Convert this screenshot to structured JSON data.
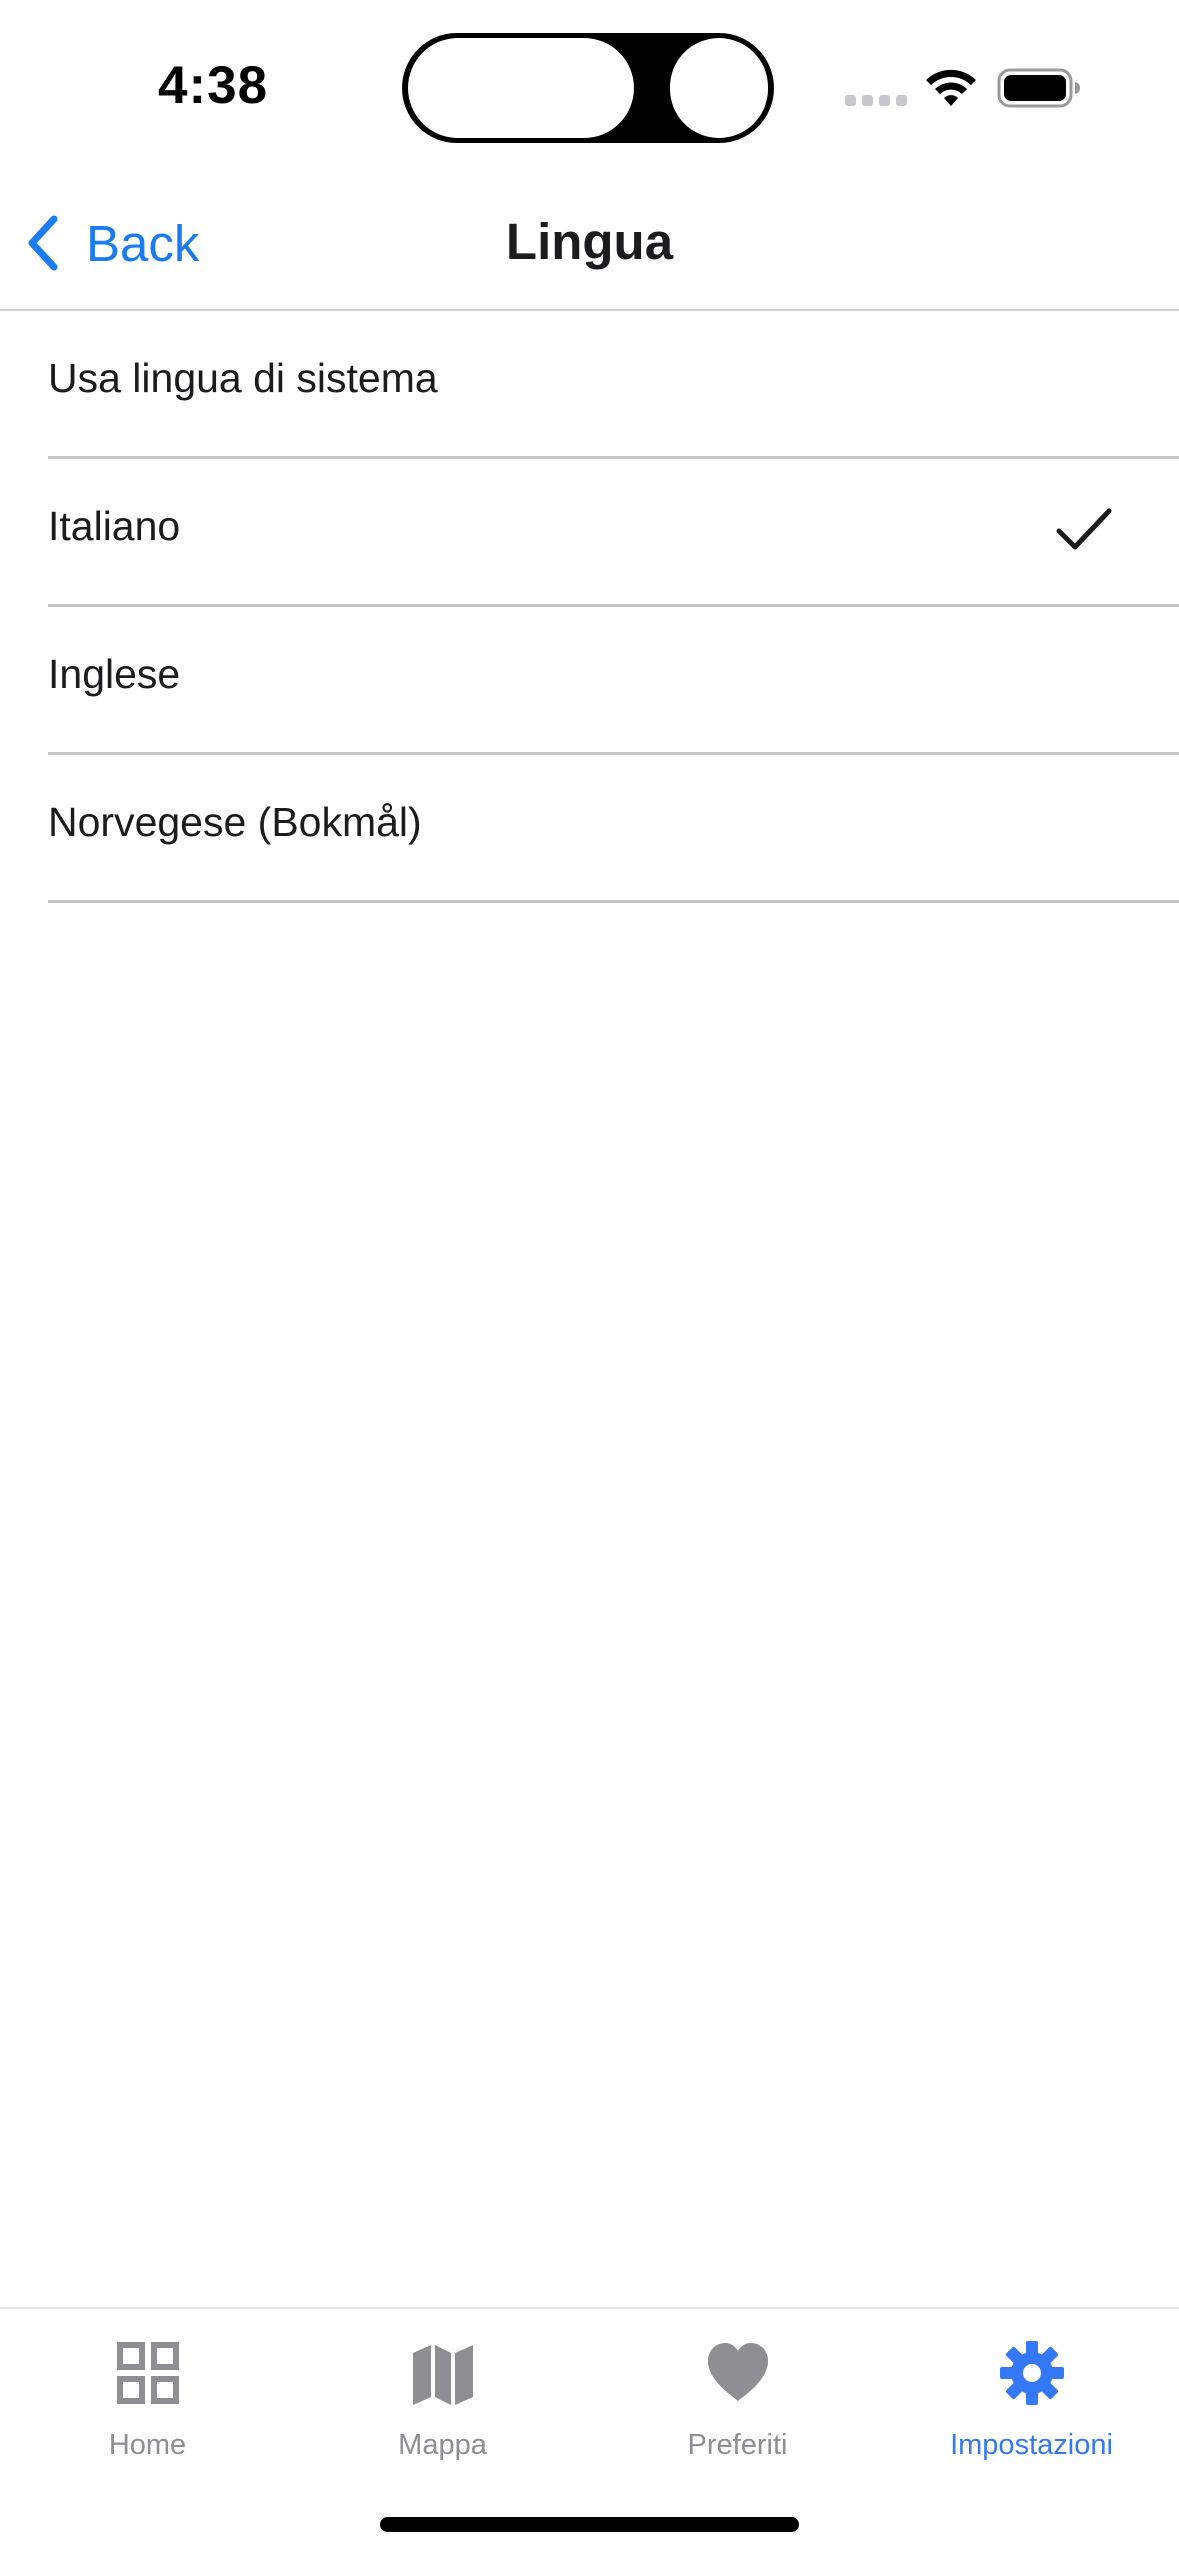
{
  "status_bar": {
    "time": "4:38"
  },
  "nav": {
    "back_label": "Back",
    "title": "Lingua"
  },
  "languages": [
    {
      "label": "Usa lingua di sistema",
      "selected": false
    },
    {
      "label": "Italiano",
      "selected": true
    },
    {
      "label": "Inglese",
      "selected": false
    },
    {
      "label": "Norvegese (Bokmål)",
      "selected": false
    }
  ],
  "tab_bar": {
    "items": [
      {
        "label": "Home",
        "icon": "grid-icon",
        "active": false
      },
      {
        "label": "Mappa",
        "icon": "map-icon",
        "active": false
      },
      {
        "label": "Preferiti",
        "icon": "heart-icon",
        "active": false
      },
      {
        "label": "Impostazioni",
        "icon": "gear-icon",
        "active": true
      }
    ]
  },
  "colors": {
    "accent": "#1a7cf0",
    "tab_active": "#3478f6",
    "tab_inactive": "#8e8e93",
    "separator": "#c6c6c8"
  }
}
